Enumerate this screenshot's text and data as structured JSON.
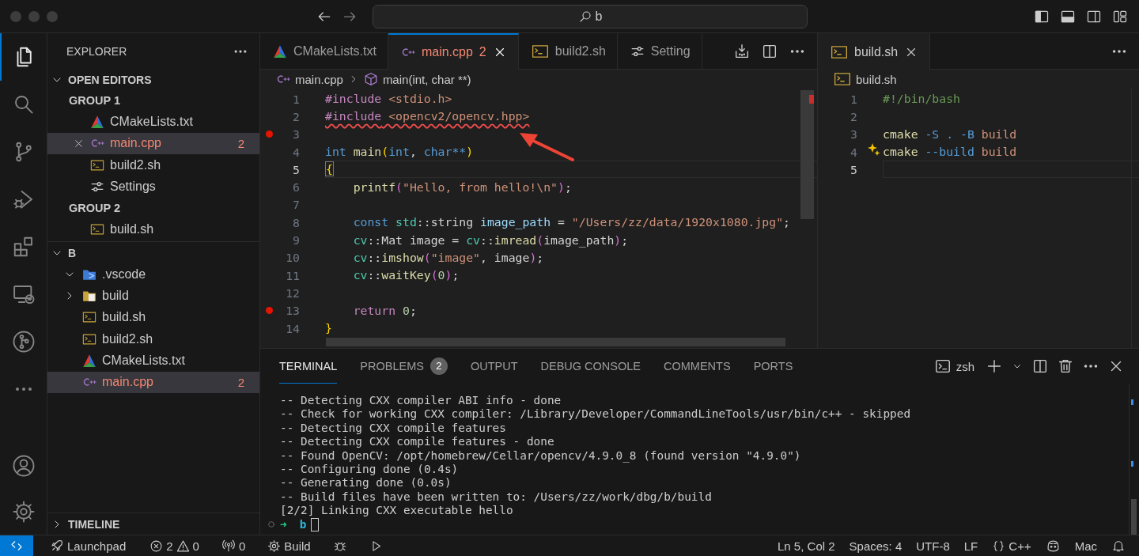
{
  "title_bar": {
    "search": "b"
  },
  "activity_bar": [
    {
      "kind": "explorer",
      "selected": true
    },
    {
      "kind": "search",
      "selected": false
    },
    {
      "kind": "source_control",
      "selected": false
    },
    {
      "kind": "run_debug",
      "selected": false
    },
    {
      "kind": "extensions",
      "selected": false
    },
    {
      "kind": "remote",
      "selected": false
    },
    {
      "kind": "git_graph",
      "selected": false
    },
    {
      "kind": "more",
      "selected": false
    }
  ],
  "activity_bar_bottom": [
    {
      "kind": "account"
    },
    {
      "kind": "manage"
    }
  ],
  "sidebar": {
    "title": "EXPLORER",
    "open_editors": {
      "title": "OPEN EDITORS",
      "expanded": true,
      "groups": [
        {
          "title": "GROUP 1",
          "items": [
            {
              "label": "CMakeLists.txt",
              "kind": "cmake",
              "selected": false,
              "error": false,
              "closable": false
            },
            {
              "label": "main.cpp",
              "kind": "cpp",
              "selected": true,
              "error": true,
              "badge": "2",
              "closable": true
            },
            {
              "label": "build2.sh",
              "kind": "shell",
              "selected": false,
              "error": false,
              "closable": false
            },
            {
              "label": "Settings",
              "kind": "settings",
              "selected": false,
              "error": false,
              "closable": false
            }
          ]
        },
        {
          "title": "GROUP 2",
          "items": [
            {
              "label": "build.sh",
              "kind": "shell",
              "selected": false,
              "error": false,
              "closable": false
            }
          ]
        }
      ]
    },
    "folder": {
      "title": "B",
      "expanded": true,
      "tree": [
        {
          "label": ".vscode",
          "kind": "folder_vscode",
          "expanded": true,
          "selected": false,
          "error": false
        },
        {
          "label": "build",
          "kind": "folder",
          "expanded": false,
          "selected": false,
          "error": false
        },
        {
          "label": "build.sh",
          "kind": "shell",
          "selected": false,
          "error": false
        },
        {
          "label": "build2.sh",
          "kind": "shell",
          "selected": false,
          "error": false
        },
        {
          "label": "CMakeLists.txt",
          "kind": "cmake",
          "selected": false,
          "error": false
        },
        {
          "label": "main.cpp",
          "kind": "cpp",
          "selected": true,
          "error": true,
          "badge": "2"
        }
      ]
    },
    "timeline": {
      "title": "TIMELINE",
      "expanded": false
    }
  },
  "editor_groups": [
    {
      "focused": true,
      "tabs": [
        {
          "label": "CMakeLists.txt",
          "kind": "cmake",
          "selected": false,
          "error": false,
          "closable": false
        },
        {
          "label": "main.cpp",
          "kind": "cpp",
          "selected": true,
          "error": true,
          "badge": "2",
          "closable": true
        },
        {
          "label": "build2.sh",
          "kind": "shell",
          "selected": false,
          "error": false,
          "closable": false
        },
        {
          "label": "Setting",
          "kind": "settings",
          "selected": false,
          "error": false,
          "closable": false
        }
      ],
      "actions": [
        {
          "kind": "save_all"
        },
        {
          "kind": "split"
        },
        {
          "kind": "more"
        }
      ],
      "breadcrumb": [
        {
          "label": "main.cpp",
          "kind": "cpp"
        },
        {
          "label": "main(int, char **)",
          "kind": "symbol"
        }
      ],
      "lines": [
        {
          "n": "1",
          "breakpoint": false,
          "current": false,
          "error": false,
          "tokens": [
            {
              "text": "#include",
              "kind": "pre"
            },
            {
              "text": " <stdio.h>",
              "kind": "str"
            }
          ]
        },
        {
          "n": "2",
          "breakpoint": false,
          "current": false,
          "error": true,
          "tokens": [
            {
              "text": "#include",
              "kind": "pre"
            },
            {
              "text": " <opencv2/opencv.hpp>",
              "kind": "str"
            }
          ]
        },
        {
          "n": "3",
          "breakpoint": true,
          "current": false,
          "error": false
        },
        {
          "n": "4",
          "breakpoint": false,
          "current": false,
          "error": false,
          "tokens": [
            {
              "text": "int",
              "kind": "kw"
            },
            {
              "text": " main",
              "kind": "fn"
            },
            {
              "text": "(",
              "kind": "br"
            },
            {
              "text": "int",
              "kind": "kw"
            },
            {
              "text": ", ",
              "kind": "plain"
            },
            {
              "text": "char",
              "kind": "kw"
            },
            {
              "text": "**",
              "kind": "kw"
            },
            {
              "text": ")",
              "kind": "br"
            }
          ]
        },
        {
          "n": "5",
          "breakpoint": false,
          "current": true,
          "error": false,
          "tokens": [
            {
              "text": "{",
              "kind": "br_match"
            }
          ]
        },
        {
          "n": "6",
          "breakpoint": false,
          "current": false,
          "error": false,
          "tokens": [
            {
              "text": "    printf",
              "kind": "fn"
            },
            {
              "text": "(",
              "kind": "br2"
            },
            {
              "text": "\"Hello, from hello!\\n\"",
              "kind": "str"
            },
            {
              "text": ")",
              "kind": "br2"
            },
            {
              "text": ";",
              "kind": "plain"
            }
          ]
        },
        {
          "n": "7",
          "breakpoint": false,
          "current": false,
          "error": false
        },
        {
          "n": "8",
          "breakpoint": false,
          "current": false,
          "error": false,
          "tokens": [
            {
              "text": "    const",
              "kind": "kw"
            },
            {
              "text": " std",
              "kind": "ns"
            },
            {
              "text": "::string ",
              "kind": "plain"
            },
            {
              "text": "image_path",
              "kind": "var"
            },
            {
              "text": " = ",
              "kind": "plain"
            },
            {
              "text": "\"/Users/zz/data/1920x1080.jpg\"",
              "kind": "str"
            },
            {
              "text": ";",
              "kind": "plain"
            }
          ]
        },
        {
          "n": "9",
          "breakpoint": false,
          "current": false,
          "error": false,
          "tokens": [
            {
              "text": "    cv",
              "kind": "ns"
            },
            {
              "text": "::Mat image = ",
              "kind": "plain"
            },
            {
              "text": "cv",
              "kind": "ns"
            },
            {
              "text": "::",
              "kind": "plain"
            },
            {
              "text": "imread",
              "kind": "fn"
            },
            {
              "text": "(",
              "kind": "br2"
            },
            {
              "text": "image_path",
              "kind": "plain"
            },
            {
              "text": ")",
              "kind": "br2"
            },
            {
              "text": ";",
              "kind": "plain"
            }
          ]
        },
        {
          "n": "10",
          "breakpoint": false,
          "current": false,
          "error": false,
          "tokens": [
            {
              "text": "    cv",
              "kind": "ns"
            },
            {
              "text": "::",
              "kind": "plain"
            },
            {
              "text": "imshow",
              "kind": "fn"
            },
            {
              "text": "(",
              "kind": "br2"
            },
            {
              "text": "\"image\"",
              "kind": "str"
            },
            {
              "text": ", image",
              "kind": "plain"
            },
            {
              "text": ")",
              "kind": "br2"
            },
            {
              "text": ";",
              "kind": "plain"
            }
          ]
        },
        {
          "n": "11",
          "breakpoint": false,
          "current": false,
          "error": false,
          "tokens": [
            {
              "text": "    cv",
              "kind": "ns"
            },
            {
              "text": "::",
              "kind": "plain"
            },
            {
              "text": "waitKey",
              "kind": "fn"
            },
            {
              "text": "(",
              "kind": "br2"
            },
            {
              "text": "0",
              "kind": "num"
            },
            {
              "text": ")",
              "kind": "br2"
            },
            {
              "text": ";",
              "kind": "plain"
            }
          ]
        },
        {
          "n": "12",
          "breakpoint": false,
          "current": false,
          "error": false
        },
        {
          "n": "13",
          "breakpoint": true,
          "current": false,
          "error": false,
          "tokens": [
            {
              "text": "    return",
              "kind": "ctl"
            },
            {
              "text": " 0",
              "kind": "num"
            },
            {
              "text": ";",
              "kind": "plain"
            }
          ]
        },
        {
          "n": "14",
          "breakpoint": false,
          "current": false,
          "error": false,
          "tokens": [
            {
              "text": "}",
              "kind": "br"
            }
          ]
        }
      ]
    },
    {
      "focused": false,
      "tabs": [
        {
          "label": "build.sh",
          "kind": "shell",
          "selected": true,
          "error": false,
          "closable": true
        }
      ],
      "actions": [
        {
          "kind": "more"
        }
      ],
      "breadcrumb": [
        {
          "label": "build.sh",
          "kind": "shell"
        }
      ],
      "lines": [
        {
          "n": "1",
          "breakpoint": false,
          "current": false,
          "error": false,
          "tokens": [
            {
              "text": "#!/bin/bash",
              "kind": "cmt"
            }
          ]
        },
        {
          "n": "2",
          "breakpoint": false,
          "current": false,
          "error": false
        },
        {
          "n": "3",
          "breakpoint": false,
          "current": false,
          "error": false,
          "tokens": [
            {
              "text": "cmake",
              "kind": "fn"
            },
            {
              "text": " -S . -B",
              "kind": "kw"
            },
            {
              "text": " build",
              "kind": "str"
            }
          ]
        },
        {
          "n": "4",
          "breakpoint": false,
          "current": false,
          "error": false,
          "tokens": [
            {
              "text": "cmake",
              "kind": "fn"
            },
            {
              "text": " --build",
              "kind": "kw"
            },
            {
              "text": " build",
              "kind": "str"
            }
          ]
        },
        {
          "n": "5",
          "breakpoint": false,
          "current": true,
          "error": false
        }
      ]
    }
  ],
  "panel": {
    "tabs": [
      {
        "label": "TERMINAL",
        "selected": true
      },
      {
        "label": "PROBLEMS",
        "selected": false,
        "badge": "2"
      },
      {
        "label": "OUTPUT",
        "selected": false
      },
      {
        "label": "DEBUG CONSOLE",
        "selected": false
      },
      {
        "label": "COMMENTS",
        "selected": false
      },
      {
        "label": "PORTS",
        "selected": false
      }
    ],
    "terminal_name": "zsh",
    "actions": [
      {
        "kind": "plus"
      },
      {
        "kind": "chevron"
      },
      {
        "kind": "split"
      },
      {
        "kind": "trash"
      },
      {
        "kind": "more"
      },
      {
        "kind": "close"
      }
    ],
    "terminal_lines": [
      "-- Detecting CXX compiler ABI info - done",
      "-- Check for working CXX compiler: /Library/Developer/CommandLineTools/usr/bin/c++ - skipped",
      "-- Detecting CXX compile features",
      "-- Detecting CXX compile features - done",
      "-- Found OpenCV: /opt/homebrew/Cellar/opencv/4.9.0_8 (found version \"4.9.0\")",
      "-- Configuring done (0.4s)",
      "-- Generating done (0.0s)",
      "-- Build files have been written to: /Users/zz/work/dbg/b/build",
      "[2/2] Linking CXX executable hello"
    ],
    "prompt": {
      "arrow": "➜",
      "dir": "b"
    }
  },
  "status_bar": {
    "left": [
      {
        "kind": "remote"
      },
      {
        "kind": "launchpad",
        "label": "Launchpad"
      },
      {
        "kind": "problems",
        "errors": "2",
        "warnings": "0"
      },
      {
        "kind": "ports",
        "label": "0"
      },
      {
        "kind": "build",
        "label": "Build"
      },
      {
        "kind": "debug"
      },
      {
        "kind": "run"
      }
    ],
    "right": [
      {
        "kind": "text",
        "label": "Ln 5, Col 2"
      },
      {
        "kind": "text",
        "label": "Spaces: 4"
      },
      {
        "kind": "text",
        "label": "UTF-8"
      },
      {
        "kind": "text",
        "label": "LF"
      },
      {
        "kind": "language",
        "label": "C++"
      },
      {
        "kind": "copilot"
      },
      {
        "kind": "text",
        "label": "Mac"
      },
      {
        "kind": "bell"
      }
    ]
  }
}
